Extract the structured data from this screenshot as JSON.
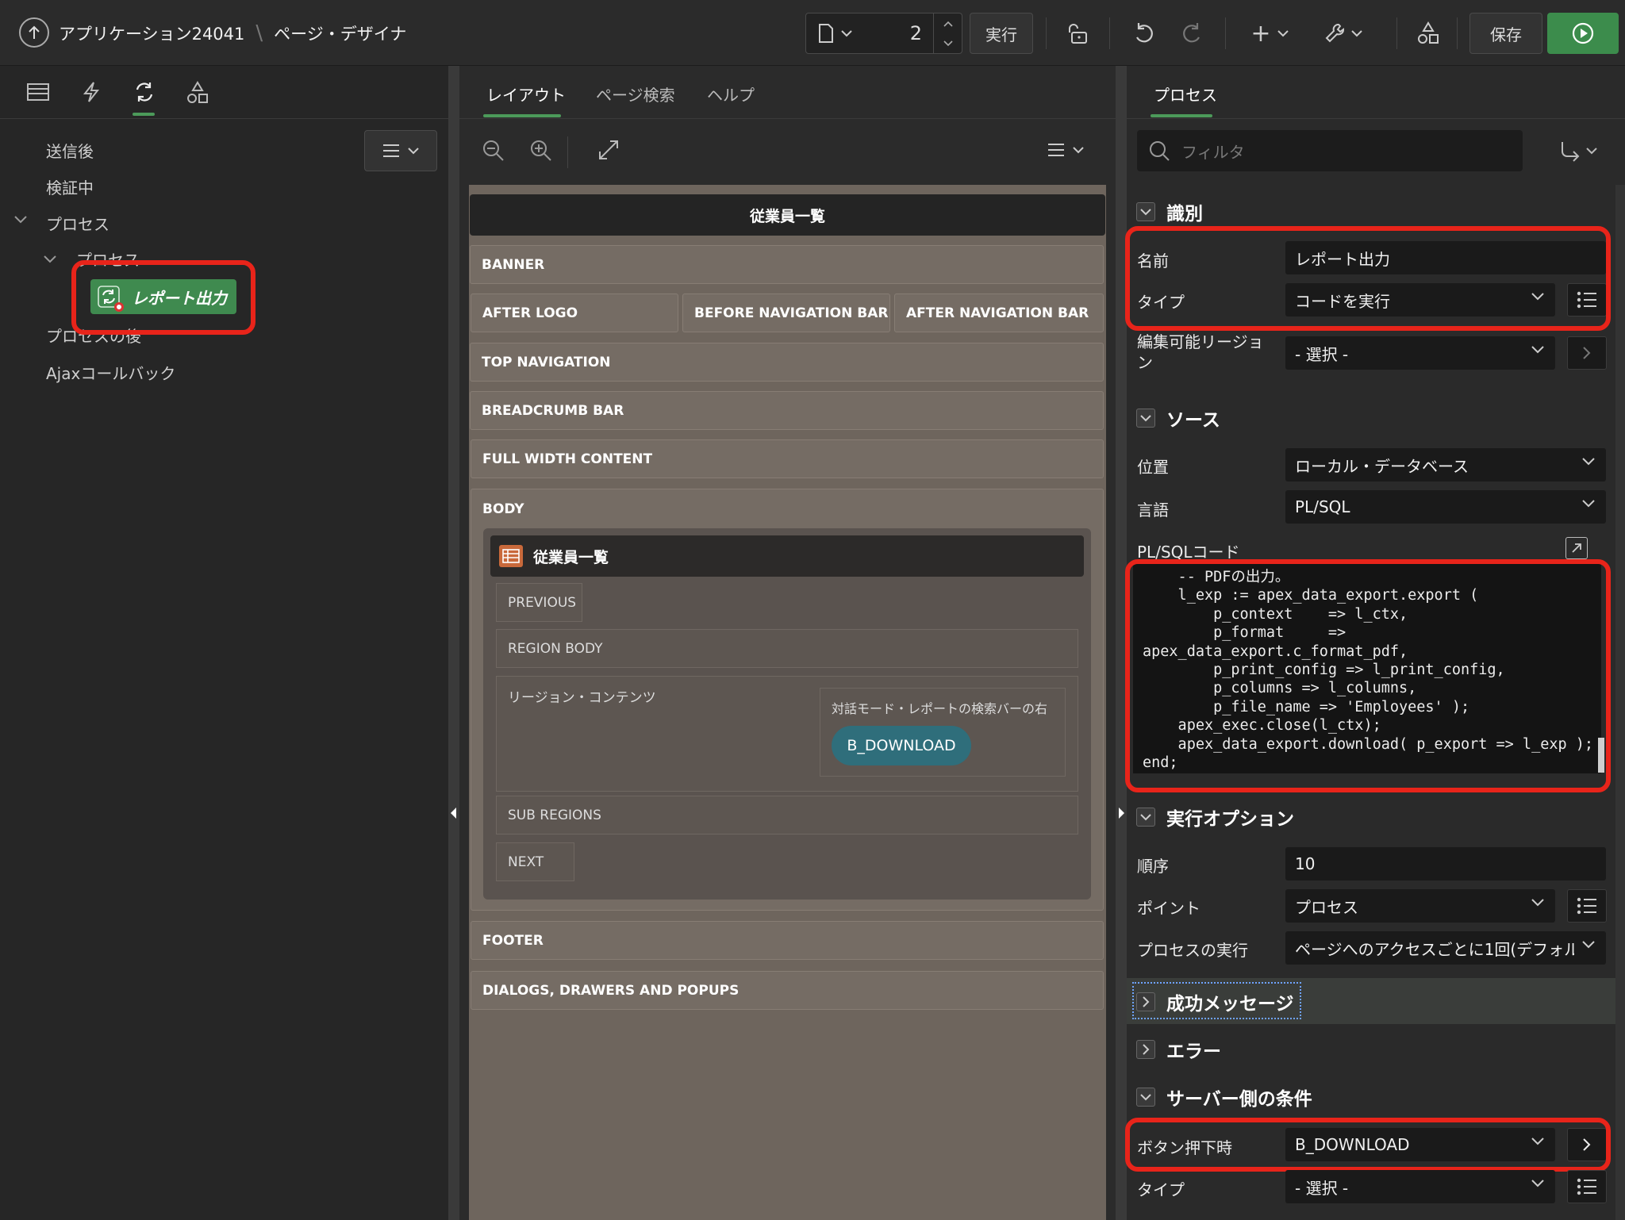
{
  "header": {
    "app_name": "アプリケーション24041",
    "separator": "\\",
    "page_designer": "ページ・デザイナ",
    "page_number": "2",
    "run_label": "実行",
    "save_label": "保存",
    "add_label": "+"
  },
  "left_tree": {
    "after_submit": "送信後",
    "validating": "検証中",
    "processes": "プロセス",
    "processes_sub": "プロセス",
    "selected_process": "レポート出力",
    "after_processing": "プロセスの後",
    "ajax_callback": "Ajaxコールバック"
  },
  "center": {
    "tabs": [
      "レイアウト",
      "ページ検索",
      "ヘルプ"
    ],
    "page_title": "従業員一覧",
    "slots": {
      "banner": "BANNER",
      "after_logo": "AFTER LOGO",
      "before_nav": "BEFORE NAVIGATION BAR",
      "after_nav": "AFTER NAVIGATION BAR",
      "top_nav": "TOP NAVIGATION",
      "breadcrumb": "BREADCRUMB BAR",
      "full_width": "FULL WIDTH CONTENT",
      "body": "BODY",
      "footer": "FOOTER",
      "dialogs": "DIALOGS, DRAWERS AND POPUPS"
    },
    "region": {
      "title": "従業員一覧",
      "previous": "PREVIOUS",
      "region_body": "REGION BODY",
      "region_content": "リージョン・コンテンツ",
      "search_bar_right": "対話モード・レポートの検索バーの右",
      "button": "B_DOWNLOAD",
      "sub_regions": "SUB REGIONS",
      "next": "NEXT"
    }
  },
  "right": {
    "tab": "プロセス",
    "filter_placeholder": "フィルタ",
    "identification": {
      "title": "識別",
      "name_label": "名前",
      "name_value": "レポート出力",
      "type_label": "タイプ",
      "type_value": "コードを実行",
      "editable_region_label_1": "編集可能リージョ",
      "editable_region_label_2": "ン",
      "editable_region_value": "- 選択 -"
    },
    "source": {
      "title": "ソース",
      "location_label": "位置",
      "location_value": "ローカル・データベース",
      "language_label": "言語",
      "language_value": "PL/SQL",
      "code_label": "PL/SQLコード",
      "code_lines": [
        "    -- PDFの出力。",
        "    l_exp := apex_data_export.export (",
        "        p_context    => l_ctx,",
        "        p_format     =>",
        "apex_data_export.c_format_pdf,",
        "        p_print_config => l_print_config,",
        "        p_columns => l_columns,",
        "        p_file_name => 'Employees' );",
        "    apex_exec.close(l_ctx);",
        "    apex_data_export.download( p_export => l_exp );",
        "end;"
      ]
    },
    "execution": {
      "title": "実行オプション",
      "sequence_label": "順序",
      "sequence_value": "10",
      "point_label": "ポイント",
      "point_value": "プロセス",
      "run_process_label": "プロセスの実行",
      "run_process_value": "ページへのアクセスごとに1回(デフォル"
    },
    "success_message": {
      "title": "成功メッセージ"
    },
    "error": {
      "title": "エラー"
    },
    "server_condition": {
      "title": "サーバー側の条件",
      "when_button_label": "ボタン押下時",
      "when_button_value": "B_DOWNLOAD",
      "type_label": "タイプ",
      "type_value": "- 選択 -"
    }
  },
  "colors": {
    "accent_green": "#4c9a5a",
    "highlight_red": "#e8241a",
    "button_teal": "#2f6e7b",
    "selected_node": "#3f8a4f"
  }
}
